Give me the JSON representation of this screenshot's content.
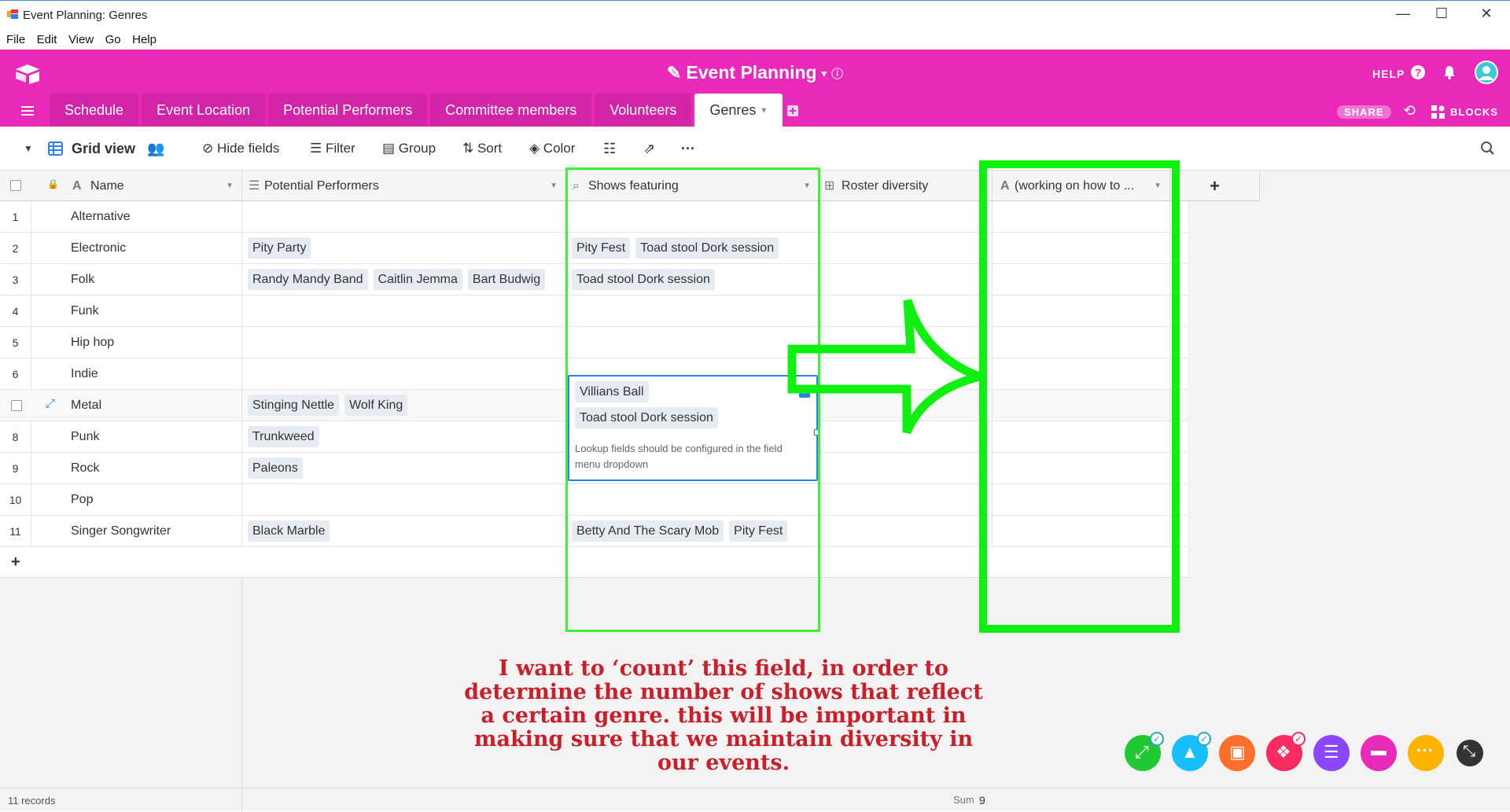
{
  "window": {
    "title": "Event Planning: Genres",
    "minimize": "—",
    "maximize": "☐",
    "close": "✕"
  },
  "menu": [
    "File",
    "Edit",
    "View",
    "Go",
    "Help"
  ],
  "header": {
    "base_title": "Event Planning",
    "help": "HELP",
    "share": "SHARE",
    "blocks": "BLOCKS",
    "tabs": [
      "Schedule",
      "Event Location",
      "Potential Performers",
      "Committee members",
      "Volunteers",
      "Genres"
    ],
    "active_tab": "Genres"
  },
  "toolbar": {
    "view_name": "Grid view",
    "hide_fields": "Hide fields",
    "filter": "Filter",
    "group": "Group",
    "sort": "Sort",
    "color": "Color"
  },
  "columns": {
    "name": "Name",
    "performers": "Potential Performers",
    "shows": "Shows featuring",
    "roster": "Roster diversity",
    "working": "(working on how to ..."
  },
  "rows": [
    {
      "n": "1",
      "name": "Alternative",
      "performers": [],
      "shows": []
    },
    {
      "n": "2",
      "name": "Electronic",
      "performers": [
        "Pity Party"
      ],
      "shows": [
        "Pity Fest",
        "Toad stool Dork session"
      ]
    },
    {
      "n": "3",
      "name": "Folk",
      "performers": [
        "Randy Mandy Band",
        "Caitlin Jemma",
        "Bart Budwig"
      ],
      "shows": [
        "Toad stool Dork session"
      ]
    },
    {
      "n": "4",
      "name": "Funk",
      "performers": [],
      "shows": []
    },
    {
      "n": "5",
      "name": "Hip hop",
      "performers": [],
      "shows": []
    },
    {
      "n": "6",
      "name": "Indie",
      "performers": [],
      "shows": []
    },
    {
      "n": "",
      "name": "Metal",
      "performers": [
        "Stinging Nettle",
        "Wolf King"
      ],
      "shows": []
    },
    {
      "n": "8",
      "name": "Punk",
      "performers": [
        "Trunkweed"
      ],
      "shows": []
    },
    {
      "n": "9",
      "name": "Rock",
      "performers": [
        "Paleons"
      ],
      "shows": []
    },
    {
      "n": "10",
      "name": "Pop",
      "performers": [],
      "shows": []
    },
    {
      "n": "11",
      "name": "Singer Songwriter",
      "performers": [
        "Black Marble"
      ],
      "shows": [
        "Betty And The Scary Mob",
        "Pity Fest"
      ]
    }
  ],
  "expanded_cell": {
    "chips": [
      "Villians Ball",
      "Toad stool Dork session"
    ],
    "hint": "Lookup fields should be configured in the field menu dropdown"
  },
  "annotation": "I want to ‘count’ this field, in order to determine the number of shows that reflect a certain genre. this will be important in making sure that we maintain diversity in our events.",
  "footer": {
    "records": "11 records",
    "sum_label": "Sum",
    "sum_value": "9"
  },
  "colors": {
    "brand": "#e929ba",
    "highlight": "#10f010",
    "note": "#c8202a"
  }
}
